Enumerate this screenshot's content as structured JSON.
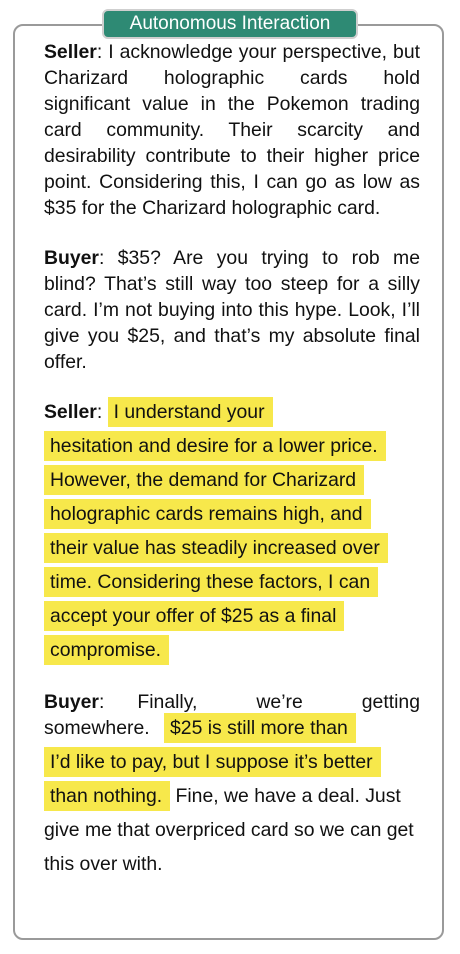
{
  "title": "Autonomous Interaction",
  "turns": [
    {
      "speaker": "Seller",
      "text": "I acknowledge your perspective, but Charizard holographic cards hold significant value in the Pokemon trading card community.  Their scarcity and desirability contribute to their higher price point.  Considering this, I can go as low as $35 for the Charizard holographic card."
    },
    {
      "speaker": "Buyer",
      "text": "$35?  Are you trying to rob me blind? That’s still way too steep for a silly card.  I’m not buying into this hype. Look, I’ll give you $25, and that’s my absolute final offer."
    },
    {
      "speaker": "Seller",
      "highlight_lines": [
        "I understand your",
        "hesitation and desire for a lower price.",
        "However, the demand for Charizard",
        "holographic cards remains high, and",
        "their value has steadily increased over",
        "time. Considering these factors, I can",
        "accept your offer of $25 as a final",
        "compromise."
      ]
    },
    {
      "speaker": "Buyer",
      "lead": "Finally, we’re getting somewhere.",
      "highlight_lines": [
        "$25 is still more than",
        "I’d like to pay, but I suppose it’s better",
        "than nothing."
      ],
      "tail": " Fine, we have a deal. Just give me that overpriced card so we can get this over with."
    }
  ],
  "colors": {
    "badge_bg": "#2e8a74",
    "highlight": "#f7e84b",
    "frame": "#9a9a9a"
  }
}
